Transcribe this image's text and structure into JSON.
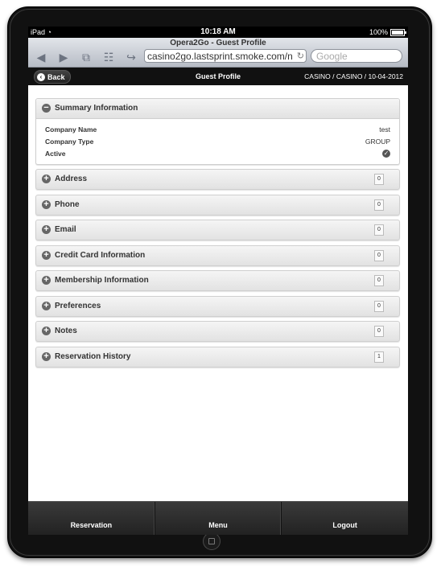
{
  "status_bar": {
    "carrier": "iPad",
    "time": "10:18 AM",
    "battery": "100%"
  },
  "browser": {
    "page_title": "Opera2Go - Guest Profile",
    "url": "casino2go.lastsprint.smoke.com/n",
    "search_placeholder": "Google",
    "icons": [
      "back-arrow-icon",
      "forward-arrow-icon",
      "pages-icon",
      "bookmarks-icon",
      "share-icon",
      "reload-icon"
    ]
  },
  "header": {
    "back_label": "Back",
    "title": "Guest Profile",
    "context": "CASINO / CASINO / 10-04-2012"
  },
  "summary": {
    "title": "Summary Information",
    "rows": [
      {
        "label": "Company Name",
        "value": "test"
      },
      {
        "label": "Company Type",
        "value": "GROUP"
      }
    ],
    "active_label": "Active",
    "active": true
  },
  "sections": [
    {
      "title": "Address",
      "count": "0"
    },
    {
      "title": "Phone",
      "count": "0"
    },
    {
      "title": "Email",
      "count": "0"
    },
    {
      "title": "Credit Card Information",
      "count": "0"
    },
    {
      "title": "Membership Information",
      "count": "0"
    },
    {
      "title": "Preferences",
      "count": "0"
    },
    {
      "title": "Notes",
      "count": "0"
    },
    {
      "title": "Reservation History",
      "count": "1"
    }
  ],
  "footer": {
    "items": [
      "Reservation",
      "Menu",
      "Logout"
    ]
  }
}
